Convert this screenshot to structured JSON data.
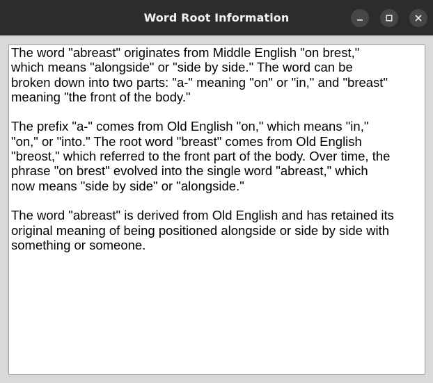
{
  "window": {
    "title": "Word Root Information",
    "controls": {
      "minimize_icon": "minimize-icon",
      "maximize_icon": "maximize-icon",
      "close_icon": "close-icon"
    }
  },
  "content": {
    "text": "The word \"abreast\" originates from Middle English \"on brest,\"\nwhich means \"alongside\" or \"side by side.\" The word can be\nbroken down into two parts: \"a-\" meaning \"on\" or \"in,\" and \"breast\"\nmeaning \"the front of the body.\"\n\nThe prefix \"a-\" comes from Old English \"on,\" which means \"in,\"\n\"on,\" or \"into.\" The root word \"breast\" comes from Old English\n\"breost,\" which referred to the front part of the body. Over time, the\nphrase \"on brest\" evolved into the single word \"abreast,\" which\nnow means \"side by side\" or \"alongside.\"\n\nThe word \"abreast\" is derived from Old English and has retained its\noriginal meaning of being positioned alongside or side by side with\nsomething or someone."
  },
  "colors": {
    "titlebar": "#2c2c2c",
    "title_text": "#f2f2f2",
    "window_bg": "#d9d9d9",
    "content_bg": "#ffffff",
    "button_bg": "#464646"
  }
}
